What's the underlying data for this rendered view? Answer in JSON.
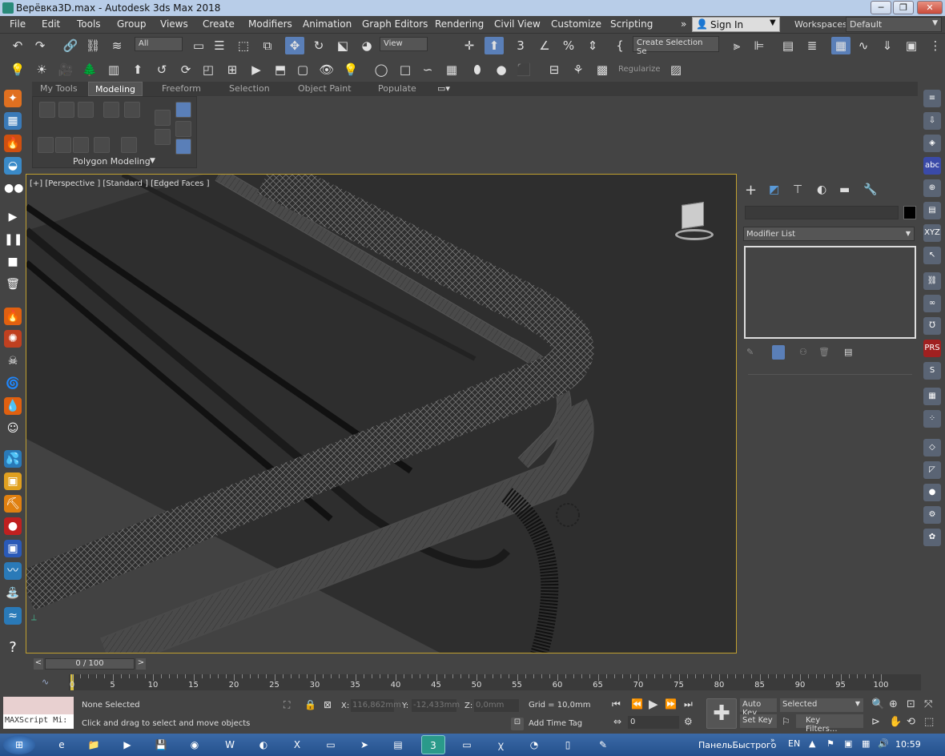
{
  "window": {
    "title": "Верёвка3D.max - Autodesk 3ds Max 2018",
    "minimize": "─",
    "restore": "❐",
    "close": "✕"
  },
  "menu": [
    "File",
    "Edit",
    "Tools",
    "Group",
    "Views",
    "Create",
    "Modifiers",
    "Animation",
    "Graph Editors",
    "Rendering",
    "Civil View",
    "Customize",
    "Scripting"
  ],
  "menu_overflow": "»",
  "signin": {
    "label": "Sign In",
    "icon": "user-icon"
  },
  "workspaces": {
    "label": "Workspaces:",
    "value": "Default"
  },
  "toolbar": {
    "filter": "All",
    "refcoord": "View",
    "selection_set": "Create Selection Se",
    "regularize": "Regularize"
  },
  "ribbon": {
    "tabs": [
      "My Tools",
      "Modeling",
      "Freeform",
      "Selection",
      "Object Paint",
      "Populate"
    ],
    "active": "Modeling",
    "panel_label": "Polygon Modeling"
  },
  "viewport": {
    "label": "[+] [Perspective ] [Standard ] [Edged Faces ]"
  },
  "command_panel": {
    "modifier_list": "Modifier List"
  },
  "timeline": {
    "frame": "0 / 100",
    "prev": "<",
    "next": ">",
    "ticks": [
      "0",
      "5",
      "10",
      "15",
      "20",
      "25",
      "30",
      "35",
      "40",
      "45",
      "50",
      "55",
      "60",
      "65",
      "70",
      "75",
      "80",
      "85",
      "90",
      "95",
      "100"
    ]
  },
  "status": {
    "maxscript": "MAXScript Mi:",
    "selection": "None Selected",
    "prompt": "Click and drag to select and move objects",
    "x_label": "X:",
    "x": "116,862mm",
    "y_label": "Y:",
    "y": "-12,433mm",
    "z_label": "Z:",
    "z": "0,0mm",
    "grid": "Grid = 10,0mm",
    "add_time_tag": "Add Time Tag",
    "auto_key": "Auto Key",
    "set_key": "Set Key",
    "key_mode": "Selected",
    "key_filters": "Key Filters...",
    "frame_field": "0"
  },
  "taskbar": {
    "lang": "EN",
    "quicklaunch": "ПанельБыстрого",
    "time": "10:59"
  },
  "colors": {
    "accent": "#5a7fb8",
    "viewport_border": "#c0a030",
    "titlebar": "#b8cde8"
  }
}
